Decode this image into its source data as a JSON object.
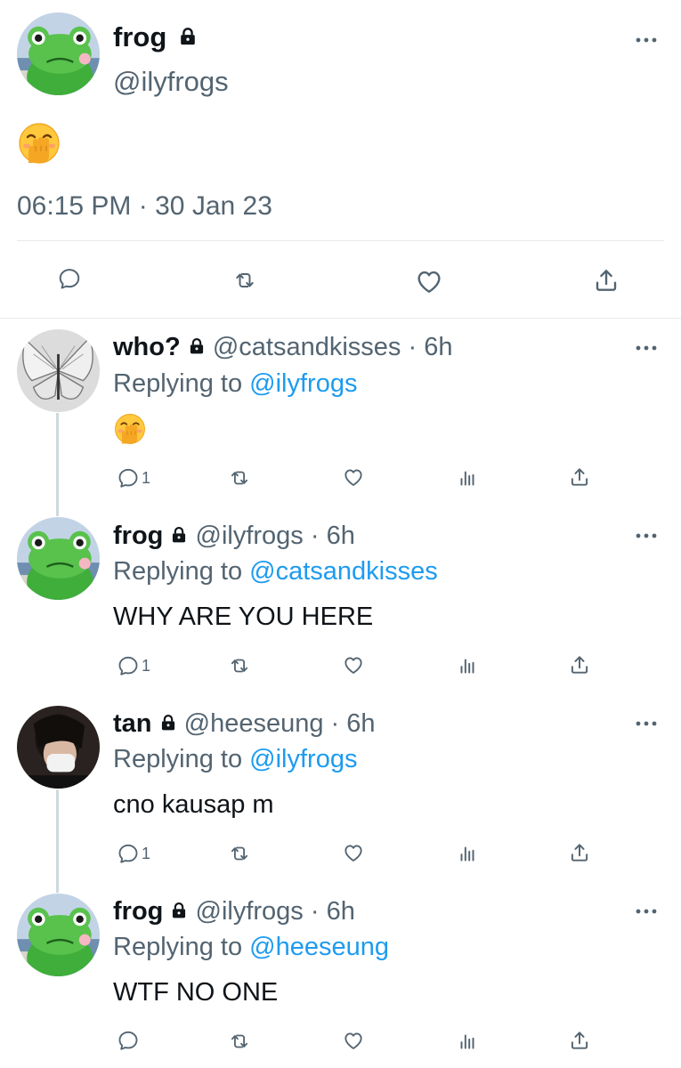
{
  "main_tweet": {
    "display_name": "frog",
    "handle": "@ilyfrogs",
    "content_emoji": "hand-over-mouth",
    "time": "06:15 PM",
    "date_separator": "·",
    "date": "30 Jan 23"
  },
  "replies": [
    {
      "display_name": "who?",
      "handle": "@catsandkisses",
      "time_ago": "· 6h",
      "replying_prefix": "Replying to",
      "replying_to": "@ilyfrogs",
      "text": "",
      "content_emoji": "hand-over-mouth",
      "reply_count": "1"
    },
    {
      "display_name": "frog",
      "handle": "@ilyfrogs",
      "time_ago": "· 6h",
      "replying_prefix": "Replying to",
      "replying_to": "@catsandkisses",
      "text": "WHY ARE YOU HERE",
      "reply_count": "1"
    },
    {
      "display_name": "tan",
      "handle": "@heeseung",
      "time_ago": "· 6h",
      "replying_prefix": "Replying to",
      "replying_to": "@ilyfrogs",
      "text": "cno kausap m",
      "reply_count": "1"
    },
    {
      "display_name": "frog",
      "handle": "@ilyfrogs",
      "time_ago": "· 6h",
      "replying_prefix": "Replying to",
      "replying_to": "@heeseung",
      "text": "WTF NO ONE",
      "reply_count": ""
    }
  ],
  "colors": {
    "link_blue": "#1d9bf0",
    "secondary_text": "#536471",
    "divider": "#e7e9ea",
    "thread_line": "#cfd9de"
  },
  "icons": [
    "more-icon",
    "lock-icon",
    "reply-icon",
    "retweet-icon",
    "like-icon",
    "share-icon",
    "analytics-icon"
  ]
}
